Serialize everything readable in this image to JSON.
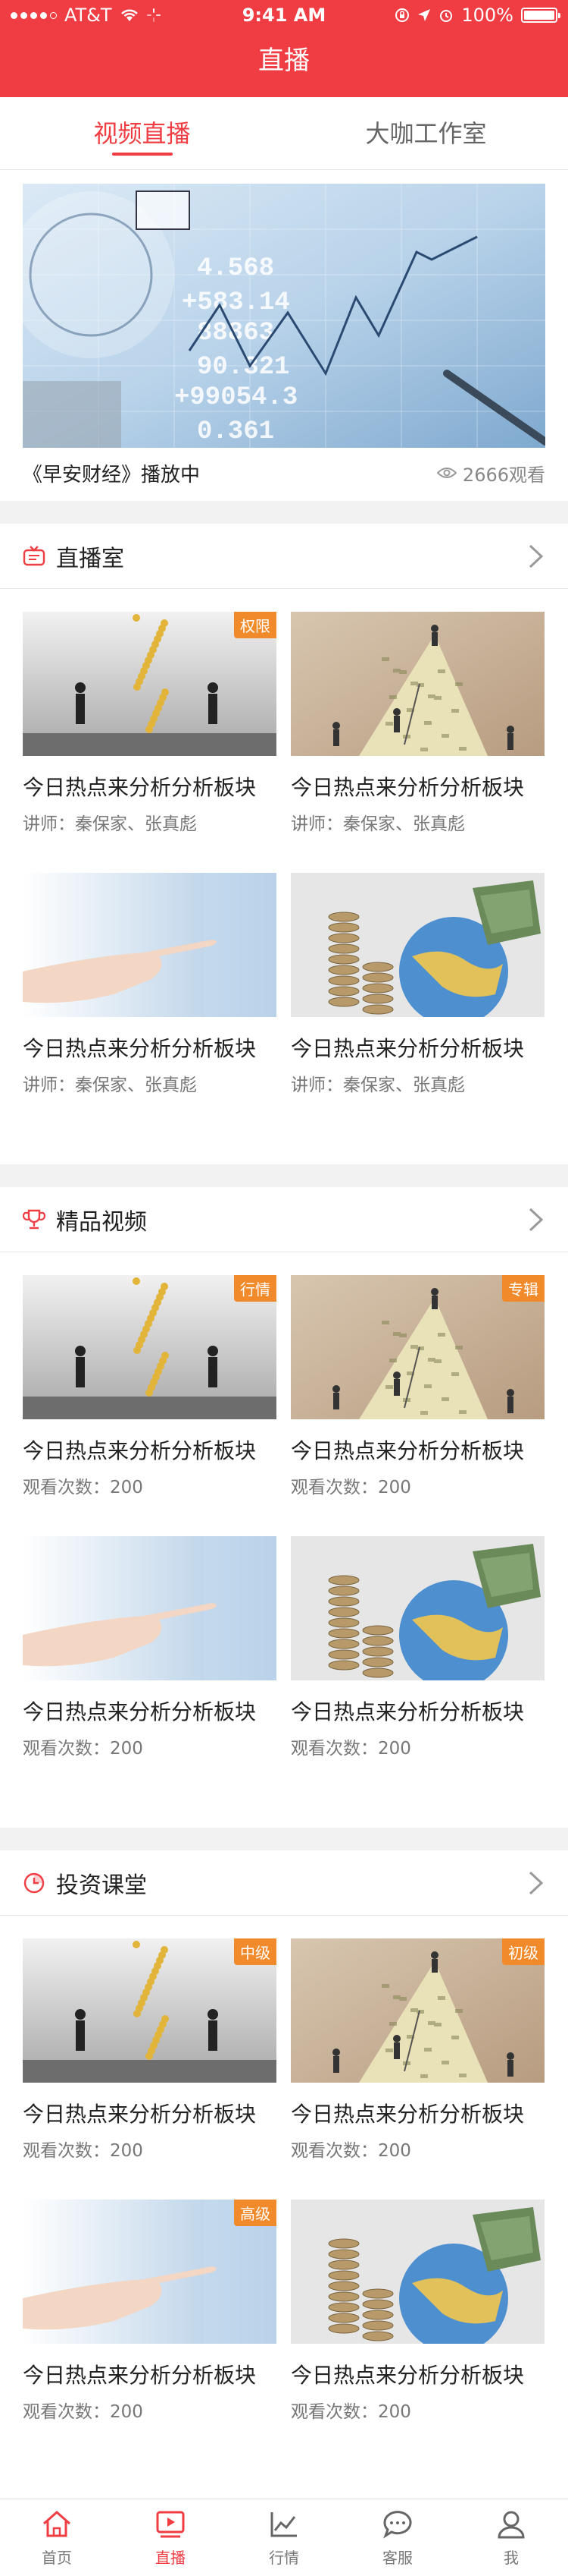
{
  "status_bar": {
    "carrier": "AT&T",
    "time": "9:41 AM",
    "battery": "100%"
  },
  "nav": {
    "title": "直播"
  },
  "tabs": [
    {
      "label": "视频直播",
      "active": true
    },
    {
      "label": "大咖工作室",
      "active": false
    }
  ],
  "hero": {
    "caption": "《早安财经》播放中",
    "views": "2666观看"
  },
  "sections": [
    {
      "title": "直播室",
      "icon": "tv-icon",
      "items": [
        {
          "title": "今日热点来分析分析板块",
          "sub": "讲师：秦保家、张真彪",
          "badge": "权限",
          "image": "business-men-coins"
        },
        {
          "title": "今日热点来分析分析板块",
          "sub": "讲师：秦保家、张真彪",
          "badge": "",
          "image": "people-money-mountain"
        },
        {
          "title": "今日热点来分析分析板块",
          "sub": "讲师：秦保家、张真彪",
          "badge": "",
          "image": "pointing-hand"
        },
        {
          "title": "今日热点来分析分析板块",
          "sub": "讲师：秦保家、张真彪",
          "badge": "",
          "image": "globe-coins-money"
        }
      ]
    },
    {
      "title": "精品视频",
      "icon": "trophy-icon",
      "items": [
        {
          "title": "今日热点来分析分析板块",
          "sub": "观看次数：200",
          "badge": "行情",
          "image": "business-men-coins"
        },
        {
          "title": "今日热点来分析分析板块",
          "sub": "观看次数：200",
          "badge": "专辑",
          "image": "people-money-mountain"
        },
        {
          "title": "今日热点来分析分析板块",
          "sub": "观看次数：200",
          "badge": "",
          "image": "pointing-hand"
        },
        {
          "title": "今日热点来分析分析板块",
          "sub": "观看次数：200",
          "badge": "",
          "image": "globe-coins-money"
        }
      ]
    },
    {
      "title": "投资课堂",
      "icon": "clock-icon",
      "items": [
        {
          "title": "今日热点来分析分析板块",
          "sub": "观看次数：200",
          "badge": "中级",
          "image": "business-men-coins"
        },
        {
          "title": "今日热点来分析分析板块",
          "sub": "观看次数：200",
          "badge": "初级",
          "image": "people-money-mountain"
        },
        {
          "title": "今日热点来分析分析板块",
          "sub": "观看次数：200",
          "badge": "高级",
          "image": "pointing-hand"
        },
        {
          "title": "今日热点来分析分析板块",
          "sub": "观看次数：200",
          "badge": "",
          "image": "globe-coins-money"
        }
      ]
    }
  ],
  "tabbar": [
    {
      "label": "首页",
      "icon": "home-icon",
      "active": false
    },
    {
      "label": "直播",
      "icon": "play-icon",
      "active": true
    },
    {
      "label": "行情",
      "icon": "chart-icon",
      "active": false
    },
    {
      "label": "客服",
      "icon": "chat-icon",
      "active": false
    },
    {
      "label": "我",
      "icon": "user-icon",
      "active": false
    }
  ],
  "colors": {
    "brand": "#ef3d43",
    "badge": "#f08a2b"
  }
}
